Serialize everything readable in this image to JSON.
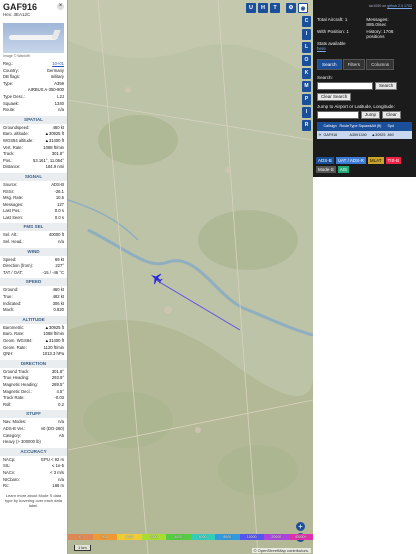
{
  "aircraft": {
    "callsign": "GAF916",
    "hex_label": "Hex: 3EA12C",
    "photo_credit": "Image © Wabloffi",
    "identity_rows": [
      {
        "k": "Reg.:",
        "v": "10+01",
        "link": true
      },
      {
        "k": "Country:",
        "v": "Germany",
        "link": false
      },
      {
        "k": "DB flags:",
        "v": "military",
        "link": false
      },
      {
        "k": "Type:",
        "v": "A359",
        "link": false
      },
      {
        "k": "",
        "v": "AIRBUS A-350-900",
        "link": false
      },
      {
        "k": "Type Desc.:",
        "v": "L2J",
        "link": false
      },
      {
        "k": "Squawk:",
        "v": "1340",
        "link": false
      },
      {
        "k": "Route:",
        "v": "n/a",
        "link": false
      }
    ],
    "sections": [
      {
        "title": "SPATIAL",
        "rows": [
          {
            "k": "Groundspeed:",
            "v": "460 kt"
          },
          {
            "k": "Baro. altitude:",
            "v": "▲30925 ft"
          },
          {
            "k": "WGS84 altitude:",
            "v": "▲31400 ft"
          },
          {
            "k": "Vert. Rate:",
            "v": "1088 ft/min"
          },
          {
            "k": "Track:",
            "v": "301.8°"
          },
          {
            "k": "Pos.:",
            "v": "53.161°, 11.064°"
          },
          {
            "k": "Distance:",
            "v": "184.9 nmi"
          }
        ]
      },
      {
        "title": "SIGNAL",
        "rows": [
          {
            "k": "Source:",
            "v": "ADS-B"
          },
          {
            "k": "RSSI:",
            "v": "-26.1"
          },
          {
            "k": "Msg. Rate:",
            "v": "10.5"
          },
          {
            "k": "Messages:",
            "v": "127"
          },
          {
            "k": "Last Pos.:",
            "v": "0.0 s"
          },
          {
            "k": "Last Seen:",
            "v": "0.0 s"
          }
        ]
      },
      {
        "title": "FMS SEL",
        "rows": [
          {
            "k": "Sel. Alt.:",
            "v": "40000 ft"
          },
          {
            "k": "Sel. Head.:",
            "v": "n/a"
          }
        ]
      },
      {
        "title": "WIND",
        "rows": [
          {
            "k": "Speed:",
            "v": "69 kt"
          },
          {
            "k": "Direction (from):",
            "v": "227°"
          },
          {
            "k": "TAT / OAT:",
            "v": "-15 / -46 °C"
          }
        ]
      },
      {
        "title": "SPEED",
        "rows": [
          {
            "k": "Ground:",
            "v": "460 kt"
          },
          {
            "k": "True:",
            "v": "482 kt"
          },
          {
            "k": "Indicated:",
            "v": "306 kt"
          },
          {
            "k": "Mach:",
            "v": "0.820"
          }
        ]
      },
      {
        "title": "ALTITUDE",
        "rows": [
          {
            "k": "Barometric:",
            "v": "▲30925 ft"
          },
          {
            "k": "Baro. Rate:",
            "v": "1088 ft/min"
          },
          {
            "k": "Geom. WGS84:",
            "v": "▲31400 ft"
          },
          {
            "k": "Geom. Rate:",
            "v": "1120 ft/min"
          },
          {
            "k": "QNH:",
            "v": "1013.3 hPa"
          }
        ]
      },
      {
        "title": "DIRECTION",
        "rows": [
          {
            "k": "Ground Track:",
            "v": "301.8°"
          },
          {
            "k": "True Heading:",
            "v": "293.9°"
          },
          {
            "k": "Magnetic Heading:",
            "v": "289.5°"
          },
          {
            "k": "Magnetic Decl.:",
            "v": "4.5°"
          },
          {
            "k": "Track Rate:",
            "v": "-0.03"
          },
          {
            "k": "Roll:",
            "v": "0.2"
          }
        ]
      },
      {
        "title": "STUFF",
        "rows": [
          {
            "k": "Nav. Modes:",
            "v": "n/a"
          },
          {
            "k": "ADS-B Ver.:",
            "v": "v0 (DO-260)"
          },
          {
            "k": "Category:",
            "v": "A5"
          },
          {
            "k": "Heavy (> 300000 lb)",
            "v": ""
          }
        ]
      },
      {
        "title": "ACCURACY",
        "rows": [
          {
            "k": "NACp:",
            "v": "EPU < 92 m"
          },
          {
            "k": "SIL:",
            "v": "≤ 1e-5"
          },
          {
            "k": "NACv:",
            "v": "< 3 m/s"
          },
          {
            "k": "NICbaro:",
            "v": "n/a"
          },
          {
            "k": "Rc:",
            "v": "186 m"
          }
        ]
      }
    ],
    "footer_note": "Learn more about Mode S data type by hovering over each data label."
  },
  "map": {
    "toolbar_buttons": [
      "U",
      "H",
      "T"
    ],
    "side_buttons": [
      "C",
      "I",
      "L",
      "O",
      "K",
      "M",
      "P",
      "I",
      "R"
    ],
    "zoom_in": "+",
    "zoom_out": "−",
    "scale_label": "1 km",
    "attribution": "© OpenStreetMap contributors.",
    "legend_colors": [
      "#d85",
      "#e93",
      "#ec3",
      "#ad3",
      "#5c4",
      "#3cb",
      "#39d",
      "#55e",
      "#a4d",
      "#d3a"
    ],
    "legend_labels": [
      "0",
      "500",
      "1000",
      "2000",
      "4000",
      "6000",
      "8000",
      "10000",
      "20000",
      "40000+"
    ],
    "route_color": "#5a4ee6",
    "plane_color": "#2a2bd6"
  },
  "right_panel": {
    "version_prefix": "tar1090 on",
    "version_link": "github 2.5 1702",
    "total_aircraft_label": "Total Aircraft: 1",
    "with_position_label": "With Position: 1",
    "messages_label": "Messages:",
    "messages_value": "885.0/sec",
    "history_label": "History: 1706 positions",
    "stats_text": "Stats available",
    "stats_link": "here",
    "tabs": [
      "Search",
      "Filters",
      "Columns"
    ],
    "search_label": "Search:",
    "search_button": "Search",
    "clear_button": "Clear Search",
    "jump_label": "Jump to Airport or Latitude, Longitude:",
    "jump_button": "Jump",
    "clear2_button": "Clear",
    "columns": [
      "",
      "Callsign",
      "Route",
      "Type",
      "Squawk",
      "Alt (ft)",
      "Spd"
    ],
    "rows": [
      [
        "✈",
        "GAF916",
        "",
        "A359",
        "1340",
        "▲30925",
        "460"
      ]
    ],
    "badges": [
      {
        "text": "ADS-B",
        "bg": "#1c4f99",
        "fg": "#fff"
      },
      {
        "text": "UAT / ADS-R",
        "bg": "#3a7bd5",
        "fg": "#fff"
      },
      {
        "text": "MLAT",
        "bg": "#c9a227",
        "fg": "#111"
      },
      {
        "text": "TIS-B",
        "bg": "#e24",
        "fg": "#fff"
      },
      {
        "text": "Mode-S",
        "bg": "#555",
        "fg": "#fff"
      },
      {
        "text": "AIS",
        "bg": "#2a7",
        "fg": "#fff"
      }
    ]
  }
}
